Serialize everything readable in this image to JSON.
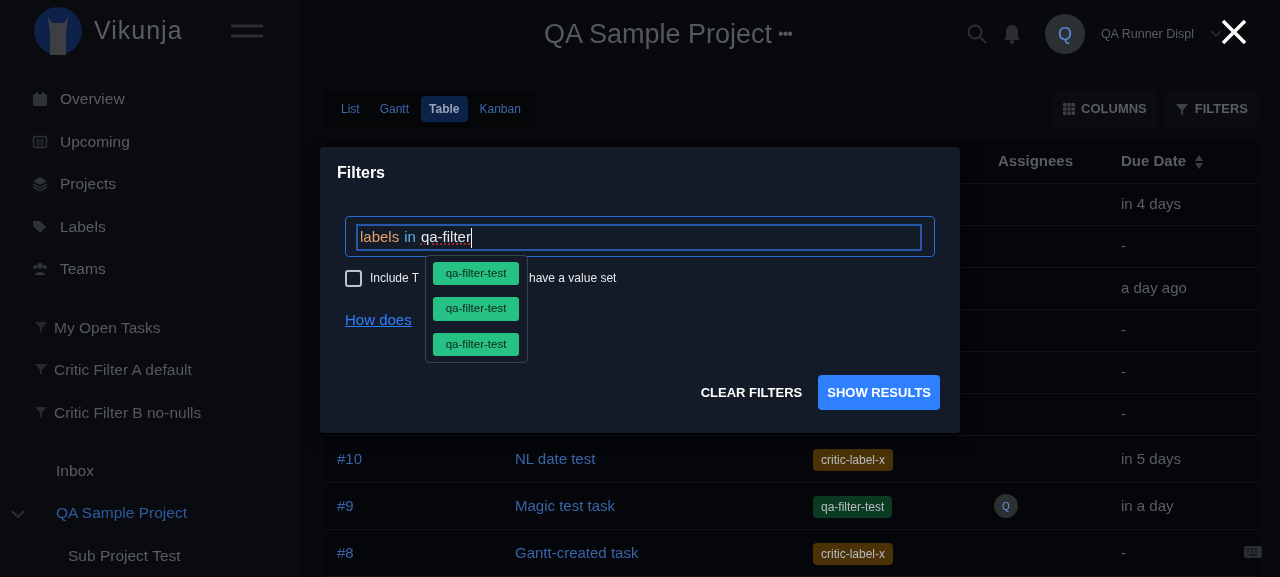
{
  "app": {
    "name": "Vikunja"
  },
  "header": {
    "title": "QA Sample Project",
    "menu_glyph": "•••",
    "avatar_letter": "Q",
    "user_name": "QA Runner Displ"
  },
  "sidebar": {
    "items": [
      {
        "label": "Overview",
        "kind": "nav"
      },
      {
        "label": "Upcoming",
        "kind": "nav"
      },
      {
        "label": "Projects",
        "kind": "nav"
      },
      {
        "label": "Labels",
        "kind": "nav"
      },
      {
        "label": "Teams",
        "kind": "nav"
      },
      {
        "label": "My Open Tasks",
        "kind": "filter"
      },
      {
        "label": "Critic Filter A default",
        "kind": "filter"
      },
      {
        "label": "Critic Filter B no-nulls",
        "kind": "filter"
      },
      {
        "label": "Inbox",
        "kind": "project",
        "selected": false
      },
      {
        "label": "QA Sample Project",
        "kind": "project",
        "selected": true,
        "expanded": true,
        "children": [
          {
            "label": "Sub Project Test",
            "kind": "project",
            "selected": false
          }
        ]
      }
    ]
  },
  "view_tabs": [
    {
      "label": "List",
      "selected": false
    },
    {
      "label": "Gantt",
      "selected": false
    },
    {
      "label": "Table",
      "selected": true
    },
    {
      "label": "Kanban",
      "selected": false
    }
  ],
  "toolbar": [
    {
      "label": "COLUMNS"
    },
    {
      "label": "FILTERS"
    }
  ],
  "table": {
    "columns": [
      {
        "label": "Assignees",
        "sortable": false
      },
      {
        "label": "Due Date",
        "sortable": true
      }
    ],
    "rows": [
      {
        "due_date": "in 4 days"
      },
      {
        "due_date": "-"
      },
      {
        "due_date": "a day ago"
      },
      {
        "due_date": "-"
      },
      {
        "due_date": "-"
      },
      {
        "due_date": "-"
      },
      {
        "id": "#10",
        "title": "NL date test",
        "label": "critic-label-x",
        "color": "#4a3206",
        "due_date": "in 5 days"
      },
      {
        "id": "#9",
        "title": "Magic test task",
        "label": "qa-filter-test",
        "color": "#0b3a22",
        "assignee": "Q",
        "due_date": "in a day"
      },
      {
        "id": "#8",
        "title": "Gantt-created task",
        "label": "critic-label-x",
        "color": "#4a3206",
        "due_date": "-"
      }
    ]
  },
  "modal": {
    "title": "Filters",
    "query": [
      {
        "text": "labels",
        "kind": "field"
      },
      {
        "text": "in",
        "kind": "operator"
      },
      {
        "text": "qa-filter",
        "kind": "value"
      }
    ],
    "checkbox": {
      "label_start": "Include T",
      "label_end": "have a value set",
      "checked": false
    },
    "help_link": "How does",
    "suggestions": [
      "qa-filter-test",
      "qa-filter-test",
      "qa-filter-test"
    ],
    "buttons": [
      {
        "label": "CLEAR FILTERS",
        "kind": "text"
      },
      {
        "label": "SHOW RESULTS",
        "kind": "primary"
      }
    ]
  }
}
